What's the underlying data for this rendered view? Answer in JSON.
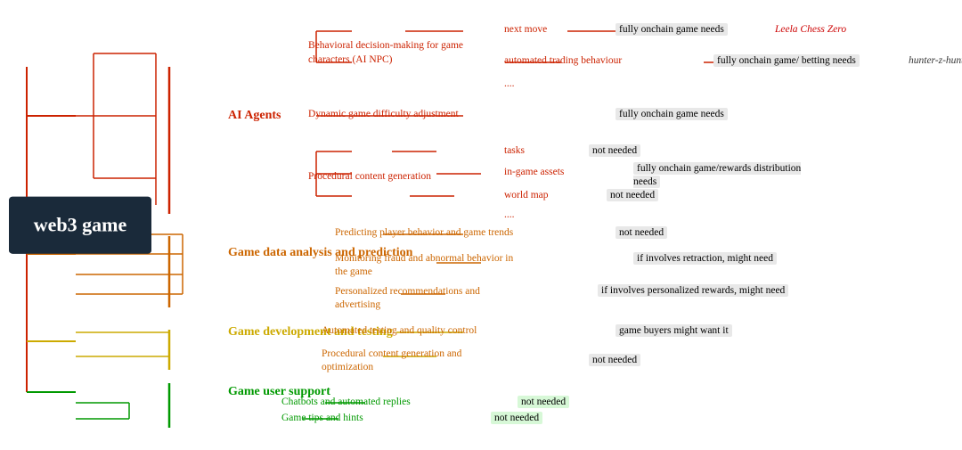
{
  "root": {
    "label": "web3 game"
  },
  "branches": {
    "ai_agents": "AI Agents",
    "game_data": "Game data analysis and prediction",
    "game_dev": "Game development and testing",
    "game_support": "Game user support"
  },
  "nodes": {
    "behavioral": "Behavioral decision-making for game\ncharacters (AI NPC)",
    "dynamic": "Dynamic game difficulty adjustment",
    "procedural": "Procedural content generation",
    "next_move": "next move",
    "automated_trading": "automated trading behaviour",
    "dots1": "....",
    "tasks": "tasks",
    "in_game_assets": "in-game assets",
    "world_map": "world map",
    "dots2": "....",
    "predicting": "Predicting player behavior and game trends",
    "monitoring": "Monitoring fraud and abnormal behavior in\nthe game",
    "personalized": "Personalized recommendations and\nadvertising",
    "automated_testing": "Automated testing and quality control",
    "procedural_opt": "Procedural content generation and\noptimization",
    "chatbots": "Chatbots and automated replies",
    "game_tips": "Game tips and hints"
  },
  "tags": {
    "fully_onchain": "fully onchain game needs",
    "fully_onchain_betting": "fully onchain game/ betting needs",
    "leela": "Leela Chess Zero",
    "hunter": "hunter-z-hunter",
    "fully_onchain2": "fully onchain game needs",
    "not_needed": "not needed",
    "fully_onchain_rewards": "fully onchain game/rewards distribution\nneeds",
    "not_needed2": "not needed",
    "not_needed3": "not needed",
    "if_retraction": "if involves retraction, might need",
    "if_personalized": "if involves personalized rewards, might need",
    "game_buyers": "game buyers might want it",
    "not_needed4": "not needed",
    "not_needed5": "not needed",
    "not_needed6": "not needed"
  }
}
